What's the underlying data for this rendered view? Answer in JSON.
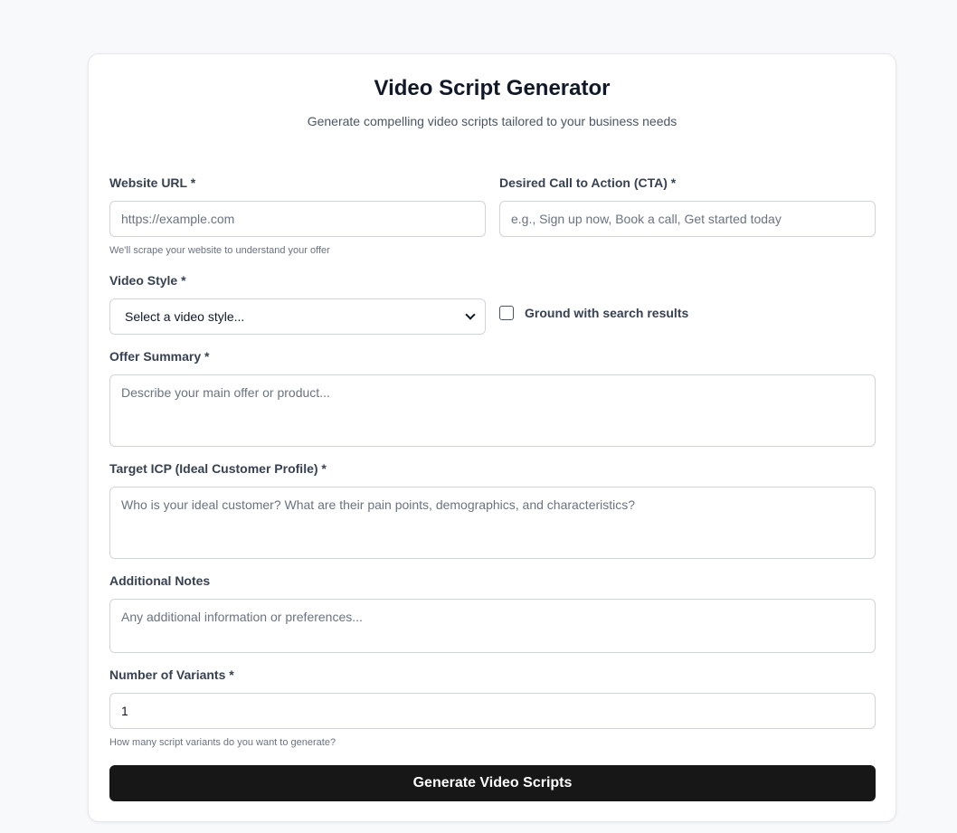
{
  "header": {
    "title": "Video Script Generator",
    "subtitle": "Generate compelling video scripts tailored to your business needs"
  },
  "form": {
    "website_url": {
      "label": "Website URL *",
      "placeholder": "https://example.com",
      "value": "",
      "hint": "We'll scrape your website to understand your offer"
    },
    "cta": {
      "label": "Desired Call to Action (CTA) *",
      "placeholder": "e.g., Sign up now, Book a call, Get started today",
      "value": ""
    },
    "video_style": {
      "label": "Video Style *",
      "selected": "Select a video style..."
    },
    "ground_search": {
      "label": "Ground with search results",
      "checked": false
    },
    "offer_summary": {
      "label": "Offer Summary *",
      "placeholder": "Describe your main offer or product...",
      "value": ""
    },
    "target_icp": {
      "label": "Target ICP (Ideal Customer Profile) *",
      "placeholder": "Who is your ideal customer? What are their pain points, demographics, and characteristics?",
      "value": ""
    },
    "additional_notes": {
      "label": "Additional Notes",
      "placeholder": "Any additional information or preferences...",
      "value": ""
    },
    "variants": {
      "label": "Number of Variants *",
      "value": "1",
      "hint": "How many script variants do you want to generate?"
    },
    "submit_label": "Generate Video Scripts"
  },
  "colors": {
    "background": "#f8f9fb",
    "button": "#171717",
    "border": "#d1d5db"
  }
}
